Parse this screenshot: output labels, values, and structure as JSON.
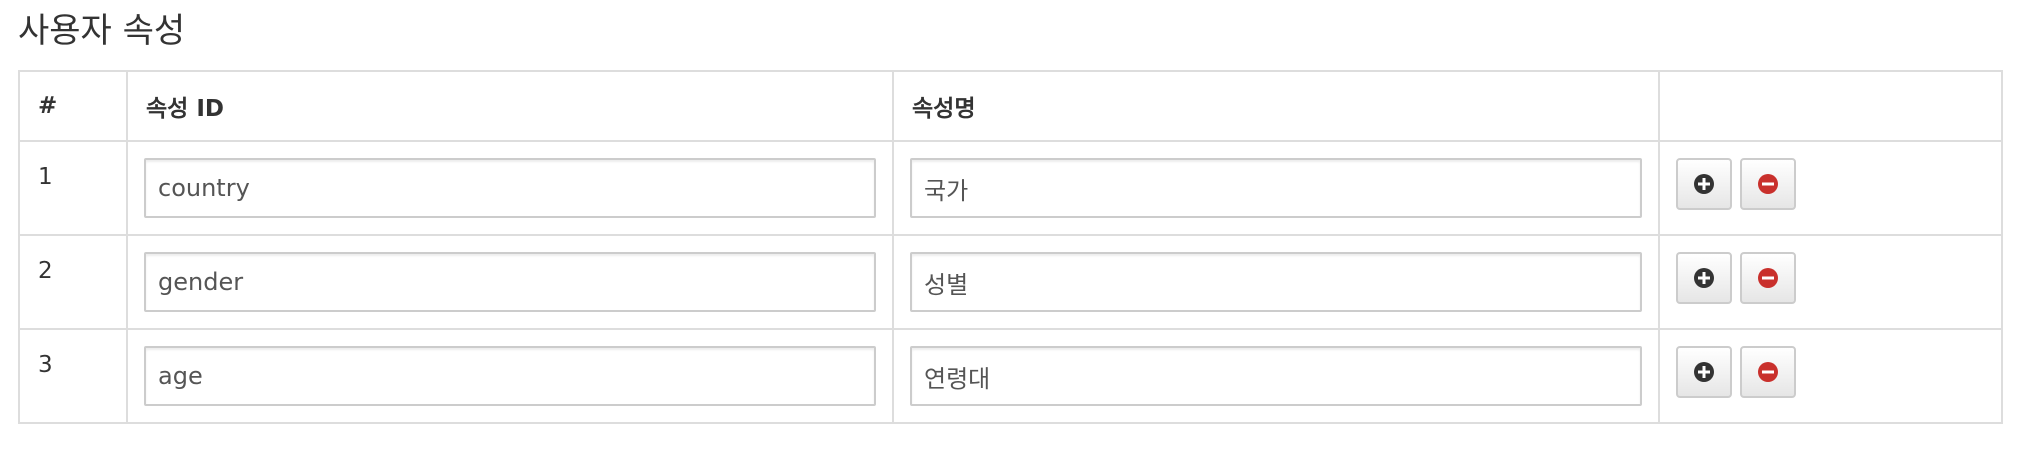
{
  "page": {
    "title": "사용자 속성"
  },
  "table": {
    "headers": {
      "num": "#",
      "attr_id": "속성 ID",
      "attr_name": "속성명",
      "actions": ""
    },
    "rows": [
      {
        "num": "1",
        "attr_id": "country",
        "attr_name": "국가"
      },
      {
        "num": "2",
        "attr_id": "gender",
        "attr_name": "성별"
      },
      {
        "num": "3",
        "attr_id": "age",
        "attr_name": "연령대"
      }
    ]
  },
  "icons": {
    "add": "plus-circle-icon",
    "remove": "minus-circle-icon"
  },
  "colors": {
    "add_icon": "#333333",
    "remove_icon": "#c9302c",
    "border": "#dddddd"
  }
}
